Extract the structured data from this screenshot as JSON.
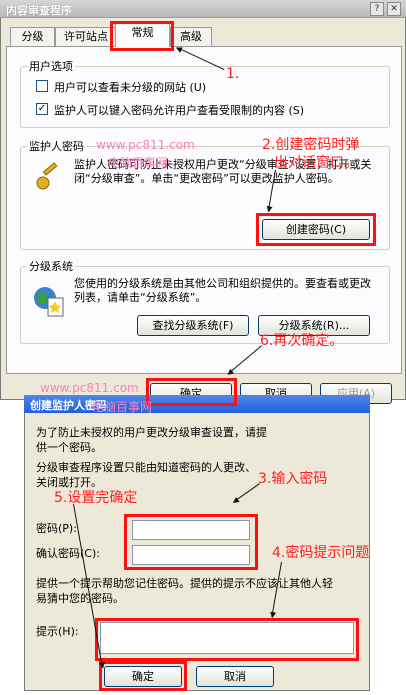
{
  "window": {
    "title": "内容审查程序",
    "help_btn": "?",
    "close_btn": "✕"
  },
  "tabs": [
    {
      "label": "分级"
    },
    {
      "label": "许可站点"
    },
    {
      "label": "常规"
    },
    {
      "label": "高级"
    }
  ],
  "user_options": {
    "legend": "用户选项",
    "opt1": "用户可以查看未分级的网站 (U)",
    "opt2": "监护人可以键入密码允许用户查看受限制的内容 (S)",
    "opt1_checked": false,
    "opt2_checked": true
  },
  "supervisor": {
    "legend": "监护人密码",
    "text": "监护人密码可防止未授权用户更改“分级审查”设置，打开或关闭“分级审查”。单击“更改密码”可以更改监护人密码。",
    "button": "创建密码(C)"
  },
  "rating": {
    "legend": "分级系统",
    "text": "您使用的分级系统是由其他公司和组织提供的。要查看或更改列表，请单击“分级系统”。",
    "find_button": "查找分级系统(F)",
    "systems_button": "分级系统(R)..."
  },
  "bottom": {
    "ok": "确定",
    "cancel": "取消",
    "apply": "应用(A)"
  },
  "watermark": "www.pc811.com",
  "watermark2": "电脑百事网",
  "annotations": {
    "a1": "1.",
    "a2": "2.创建密码时弹",
    "a2b": "出对话窗口。",
    "a3": "3.输入密码",
    "a4": "4.密码提示问题",
    "a5": "5.设置完确定",
    "a6": "6.再次确定。"
  },
  "dialog": {
    "title": "创建监护人密码",
    "intro": "为了防止未授权的用户更改分级审查设置，请提供一个密码。",
    "note": "分级审查程序设置只能由知道密码的人更改、关闭或打开。",
    "pwd_label": "密码(P):",
    "confirm_label": "确认密码(C):",
    "pwd_value": "",
    "confirm_value": "",
    "hint_intro": "提供一个提示帮助您记住密码。提供的提示不应该让其他人轻易猜中您的密码。",
    "hint_label": "提示(H):",
    "hint_value": "",
    "ok": "确定",
    "cancel": "取消"
  }
}
